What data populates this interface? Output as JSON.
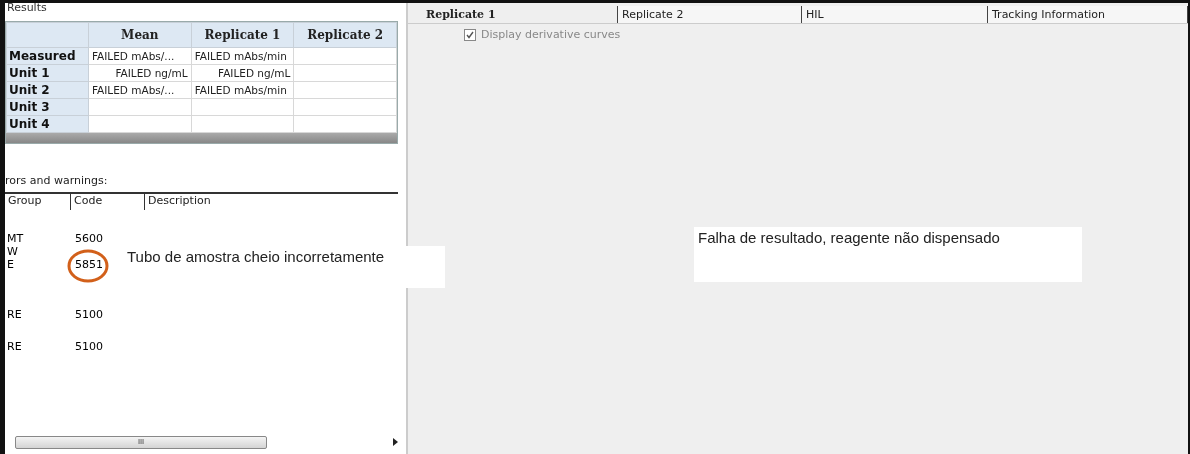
{
  "results": {
    "title": "Results",
    "columns": [
      "Mean",
      "Replicate 1",
      "Replicate 2"
    ],
    "rows": [
      {
        "label": "Measured",
        "cells": [
          "FAILED mAbs/...",
          "FAILED mAbs/min",
          ""
        ]
      },
      {
        "label": "Unit 1",
        "cells": [
          "FAILED ng/mL",
          "FAILED ng/mL",
          ""
        ]
      },
      {
        "label": "Unit 2",
        "cells": [
          "FAILED mAbs/...",
          "FAILED mAbs/min",
          ""
        ]
      },
      {
        "label": "Unit 3",
        "cells": [
          "",
          "",
          ""
        ]
      },
      {
        "label": "Unit 4",
        "cells": [
          "",
          "",
          ""
        ]
      }
    ]
  },
  "errors": {
    "title": "rors and warnings:",
    "columns": [
      "Group",
      "Code",
      "Description"
    ],
    "rows": [
      {
        "group": "MT",
        "code": "5600",
        "circled": false
      },
      {
        "group": "W",
        "code": "",
        "circled": false
      },
      {
        "group": "E",
        "code": "5851",
        "circled": true,
        "note": "Tubo de amostra cheio incorretamente"
      },
      {
        "group": "RE",
        "code": "5100",
        "circled": false
      },
      {
        "group": "RE",
        "code": "5100",
        "circled": false
      }
    ],
    "scroll_glyph": "III"
  },
  "tabs": [
    {
      "label": "Replicate 1",
      "selected": true
    },
    {
      "label": "Replicate 2",
      "selected": false
    },
    {
      "label": "HIL",
      "selected": false
    },
    {
      "label": "Tracking Information",
      "selected": false
    }
  ],
  "derivative": {
    "label": "Display derivative curves",
    "checked": true,
    "disabled": true
  },
  "note": "Falha de resultado, reagente não dispensado"
}
